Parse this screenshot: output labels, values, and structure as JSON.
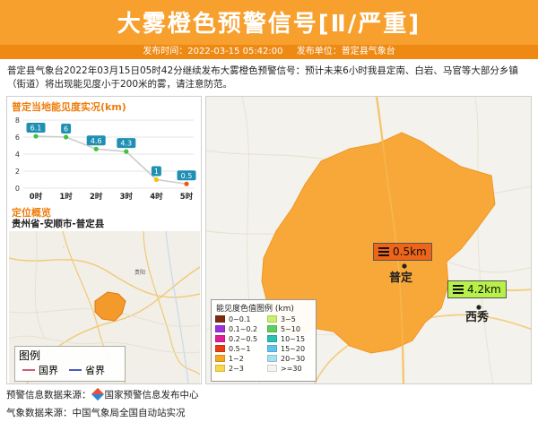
{
  "header": {
    "title": "大雾橙色预警信号[Ⅱ/严重]",
    "publish_time_label": "发布时间：2022-03-15 05:42:00",
    "publish_unit_label": "发布单位：普定县气象台",
    "bg_color": "#f7a02e"
  },
  "description": "普定县气象台2022年03月15日05时42分继续发布大雾橙色预警信号：预计未来6小时我县定南、白岩、马官等大部分乡镇（街道）将出现能见度小于200米的雾，请注意防范。",
  "visibility_chart": {
    "title": "普定当地能见度实况(km)",
    "chart_data": {
      "type": "line",
      "categories": [
        "0时",
        "1时",
        "2时",
        "3时",
        "4时",
        "5时"
      ],
      "values": [
        6.1,
        6,
        4.6,
        4.3,
        1,
        0.5
      ],
      "value_labels": [
        "6.1",
        "6",
        "4.6",
        "4.3",
        "1",
        "0.5"
      ],
      "ylim": [
        0,
        8
      ],
      "yticks": [
        "0",
        "2",
        "4",
        "6",
        "8"
      ],
      "grid": true,
      "point_colors": [
        "#3cc43c",
        "#3cc43c",
        "#3cc43c",
        "#3cc43c",
        "#f5c400",
        "#e85f12"
      ],
      "line_color": "#cccccc",
      "label_bg": "#1f8fb4"
    }
  },
  "location": {
    "title": "定位概览",
    "path": "贵州省-安顺市-普定县",
    "legend": {
      "title": "图例",
      "items": [
        {
          "label": "国界",
          "color": "#c8607a"
        },
        {
          "label": "省界",
          "color": "#4a5cc4"
        }
      ]
    }
  },
  "map": {
    "city_label": "普定",
    "town_label": "西秀",
    "fog_color": "#f9a530",
    "badges": [
      {
        "label": "0.5km",
        "bg": "#ee6418"
      },
      {
        "label": "4.2km",
        "bg": "#b8f04a"
      }
    ],
    "legend": {
      "title": "能见度色值图例 (km)",
      "items": [
        {
          "label": "0~0.1",
          "color": "#7b2d12"
        },
        {
          "label": "3~5",
          "color": "#c8f06e"
        },
        {
          "label": "0.1~0.2",
          "color": "#9b30e0"
        },
        {
          "label": "5~10",
          "color": "#5cd05c"
        },
        {
          "label": "0.2~0.5",
          "color": "#e01c9a"
        },
        {
          "label": "10~15",
          "color": "#2cc0b4"
        },
        {
          "label": "0.5~1",
          "color": "#e83c14"
        },
        {
          "label": "15~20",
          "color": "#62c4ee"
        },
        {
          "label": "1~2",
          "color": "#f5a823"
        },
        {
          "label": "20~30",
          "color": "#a8dff5"
        },
        {
          "label": "2~3",
          "color": "#f8d848"
        },
        {
          "label": ">=30",
          "color": "#f4f4f4"
        }
      ]
    }
  },
  "footer": {
    "warning_source_prefix": "预警信息数据来源：",
    "warning_source_name": "国家预警信息发布中心",
    "weather_source": "气象数据来源：中国气象局全国自动站实况"
  }
}
